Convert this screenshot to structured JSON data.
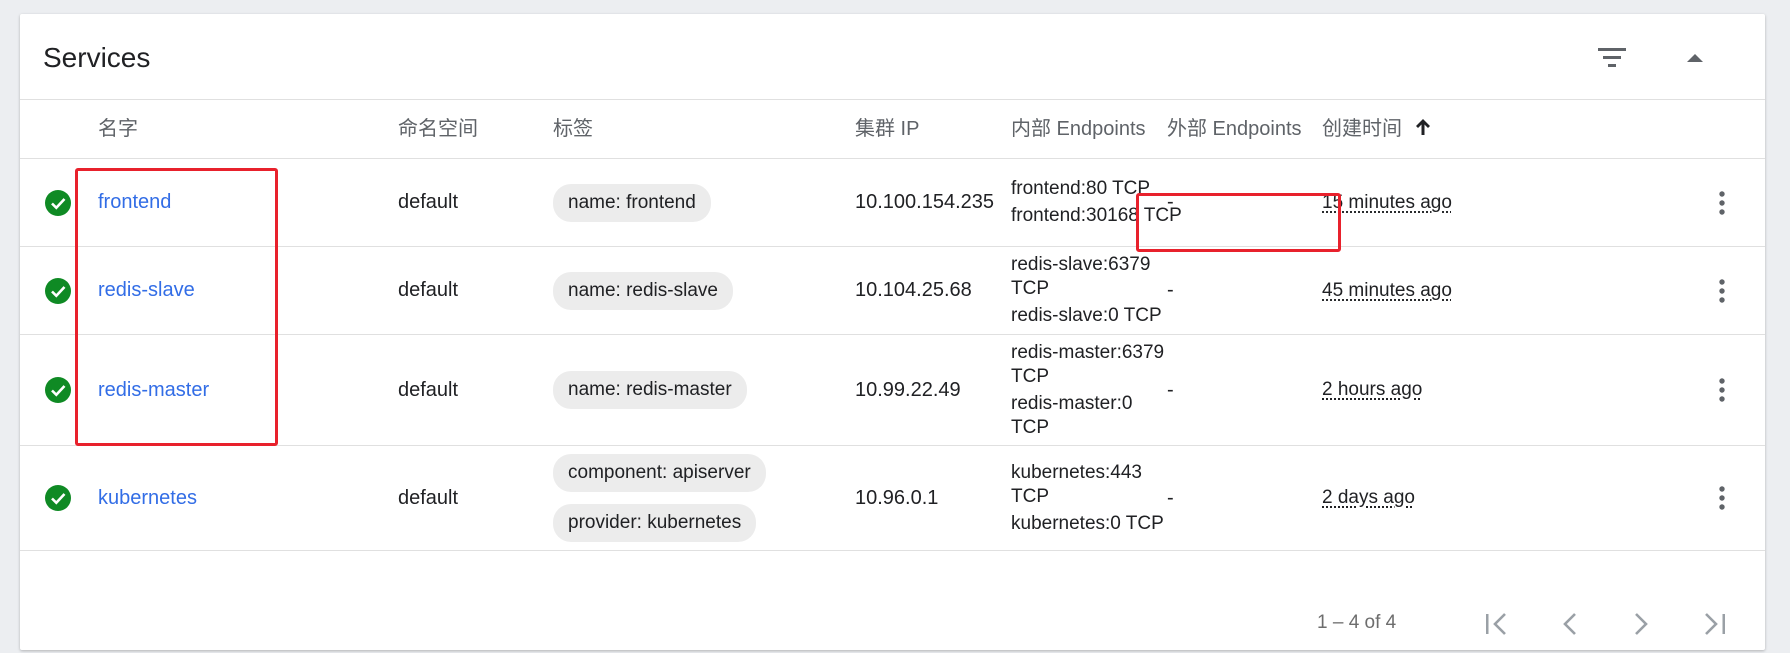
{
  "card": {
    "title": "Services",
    "filter_icon": "filter-list-icon",
    "collapse_icon": "arrow-drop-up-icon"
  },
  "columns": {
    "name": "名字",
    "namespace": "命名空间",
    "labels": "标签",
    "cluster_ip": "集群 IP",
    "internal_endpoints": "内部 Endpoints",
    "external_endpoints": "外部 Endpoints",
    "created": "创建时间",
    "sort_icon": "arrow-upward-icon"
  },
  "rows": [
    {
      "status_icon": "check-circle-icon",
      "name": "frontend",
      "namespace": "default",
      "labels": [
        "name: frontend"
      ],
      "cluster_ip": "10.100.154.235",
      "internal_endpoints": [
        "frontend:80 TCP",
        "frontend:30168 TCP"
      ],
      "external_endpoints": "-",
      "created": "15 minutes ago"
    },
    {
      "status_icon": "check-circle-icon",
      "name": "redis-slave",
      "namespace": "default",
      "labels": [
        "name: redis-slave"
      ],
      "cluster_ip": "10.104.25.68",
      "internal_endpoints": [
        "redis-slave:6379 TCP",
        "redis-slave:0 TCP"
      ],
      "external_endpoints": "-",
      "created": "45 minutes ago"
    },
    {
      "status_icon": "check-circle-icon",
      "name": "redis-master",
      "namespace": "default",
      "labels": [
        "name: redis-master"
      ],
      "cluster_ip": "10.99.22.49",
      "internal_endpoints": [
        "redis-master:6379 TCP",
        "redis-master:0 TCP"
      ],
      "external_endpoints": "-",
      "created": "2 hours ago"
    },
    {
      "status_icon": "check-circle-icon",
      "name": "kubernetes",
      "namespace": "default",
      "labels": [
        "component: apiserver",
        "provider: kubernetes"
      ],
      "cluster_ip": "10.96.0.1",
      "internal_endpoints": [
        "kubernetes:443 TCP",
        "kubernetes:0 TCP"
      ],
      "external_endpoints": "-",
      "created": "2 days ago"
    }
  ],
  "pagination": {
    "range_text": "1 – 4 of 4",
    "first_icon": "first-page-icon",
    "prev_icon": "chevron-left-icon",
    "next_icon": "chevron-right-icon",
    "last_icon": "last-page-icon"
  },
  "colors": {
    "link": "#326de6",
    "status_ok": "#0f8a24",
    "highlight": "#e8212c"
  }
}
